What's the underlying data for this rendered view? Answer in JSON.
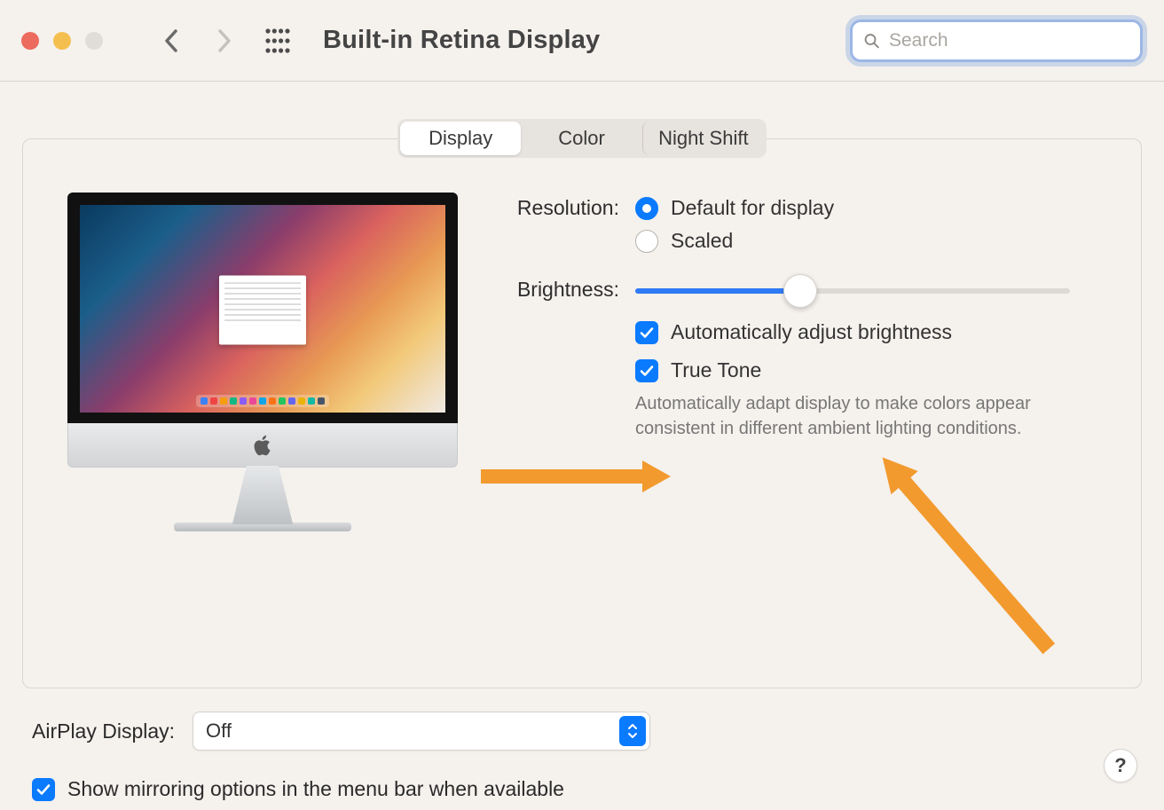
{
  "window": {
    "title": "Built-in Retina Display",
    "search_placeholder": "Search"
  },
  "tabs": [
    {
      "label": "Display",
      "active": true
    },
    {
      "label": "Color",
      "active": false
    },
    {
      "label": "Night Shift",
      "active": false
    }
  ],
  "settings": {
    "resolution": {
      "label": "Resolution:",
      "options": [
        {
          "label": "Default for display",
          "selected": true
        },
        {
          "label": "Scaled",
          "selected": false
        }
      ]
    },
    "brightness": {
      "label": "Brightness:",
      "value_percent": 38
    },
    "auto_brightness": {
      "label": "Automatically adjust brightness",
      "checked": true
    },
    "true_tone": {
      "label": "True Tone",
      "checked": true,
      "description": "Automatically adapt display to make colors appear consistent in different ambient lighting conditions."
    }
  },
  "airplay": {
    "label": "AirPlay Display:",
    "value": "Off"
  },
  "mirroring": {
    "label": "Show mirroring options in the menu bar when available",
    "checked": true
  },
  "help_button": "?",
  "annotation": {
    "color": "#f29a2e"
  }
}
